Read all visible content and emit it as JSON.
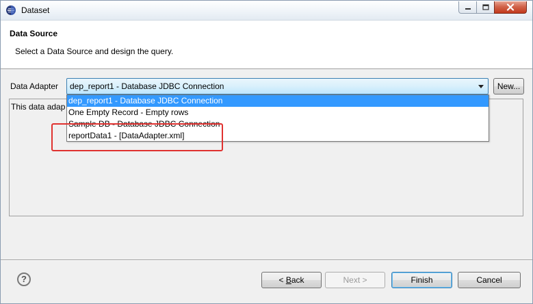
{
  "window": {
    "title": "Dataset",
    "icons": {
      "app": "eclipse-icon",
      "minimize": "minimize-icon",
      "maximize": "maximize-icon",
      "close": "close-icon"
    }
  },
  "header": {
    "title": "Data Source",
    "description": "Select a Data Source and design the query."
  },
  "adapter": {
    "label": "Data Adapter",
    "selected": "dep_report1 - Database JDBC Connection",
    "new_button": "New..."
  },
  "content": {
    "text": "This data adap"
  },
  "dropdown": {
    "options": [
      {
        "label": "dep_report1 - Database JDBC Connection",
        "selected": true
      },
      {
        "label": "One Empty Record - Empty rows",
        "selected": false
      },
      {
        "label": "Sample DB - Database JDBC Connection",
        "selected": false
      },
      {
        "label": "reportData1 - [DataAdapter.xml]",
        "selected": false
      }
    ],
    "selection_color": "#3399ff",
    "annotation_color": "#e0312f"
  },
  "footer": {
    "help_icon": "help-icon",
    "help_glyph": "?",
    "back_prefix": "< ",
    "back_mnemonic": "B",
    "back_rest": "ack",
    "next_label": "Next >",
    "finish_label": "Finish",
    "cancel_label": "Cancel"
  }
}
